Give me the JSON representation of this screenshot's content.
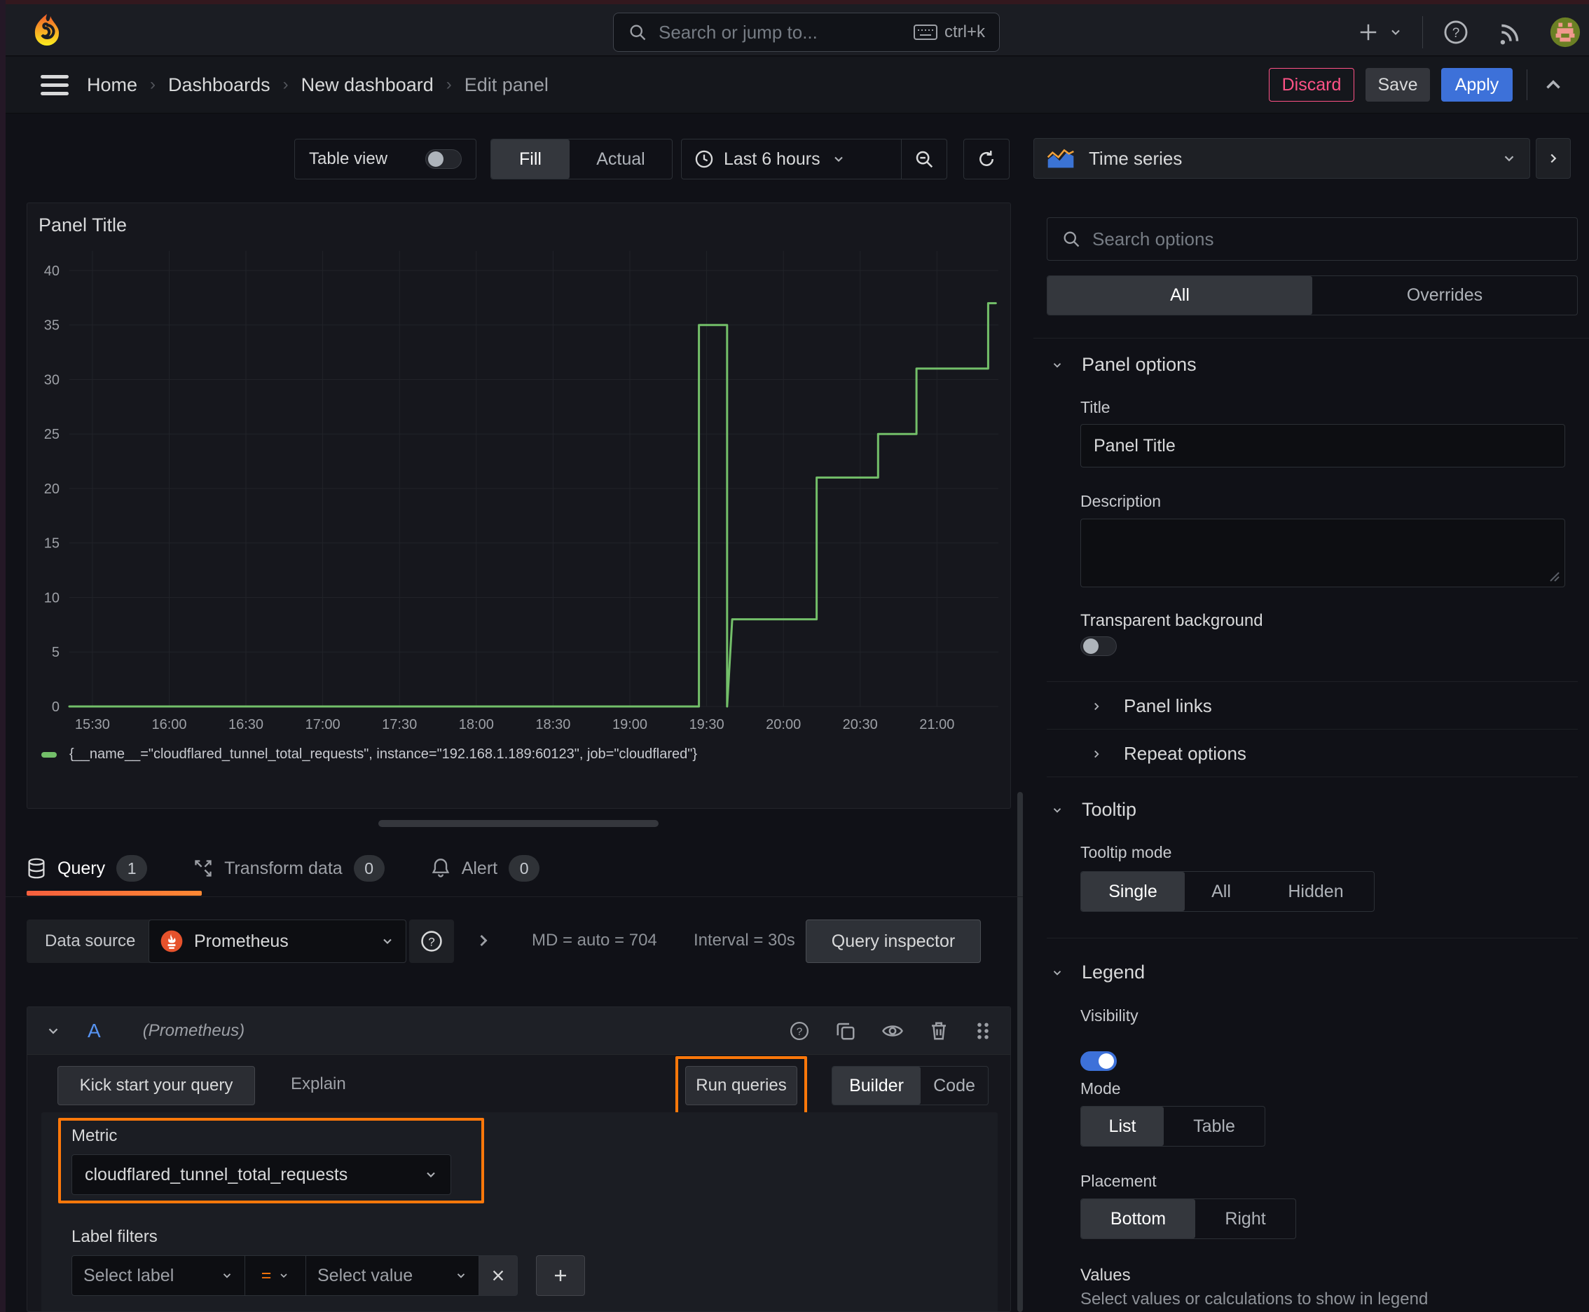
{
  "nav": {
    "search_placeholder": "Search or jump to...",
    "shortcut": "ctrl+k"
  },
  "breadcrumb": {
    "items": [
      "Home",
      "Dashboards",
      "New dashboard",
      "Edit panel"
    ]
  },
  "actions": {
    "discard": "Discard",
    "save": "Save",
    "apply": "Apply"
  },
  "toolbar": {
    "table_view": "Table view",
    "fill": "Fill",
    "actual": "Actual",
    "time_range": "Last 6 hours"
  },
  "viz": {
    "name": "Time series"
  },
  "panel": {
    "title": "Panel Title"
  },
  "chart_data": {
    "type": "line",
    "title": "Panel Title",
    "xlabel": "",
    "ylabel": "",
    "grid": true,
    "legend_position": "bottom",
    "x_tick_labels": [
      "15:30",
      "16:00",
      "16:30",
      "17:00",
      "17:30",
      "18:00",
      "18:30",
      "19:00",
      "19:30",
      "20:00",
      "20:30",
      "21:00"
    ],
    "x_ticks_minutes": [
      930,
      960,
      990,
      1020,
      1050,
      1080,
      1110,
      1140,
      1170,
      1200,
      1230,
      1260
    ],
    "y_ticks": [
      0,
      5,
      10,
      15,
      20,
      25,
      30,
      35,
      40
    ],
    "ylim": [
      0,
      41.8
    ],
    "x_domain_minutes": [
      921,
      1284
    ],
    "series": [
      {
        "name": "{__name__=\"cloudflared_tunnel_total_requests\", instance=\"192.168.1.189:60123\", job=\"cloudflared\"}",
        "color": "#73bf69",
        "points": [
          [
            921,
            0
          ],
          [
            1167,
            0
          ],
          [
            1167,
            35
          ],
          [
            1178,
            35
          ],
          [
            1178,
            0
          ],
          [
            1180,
            8
          ],
          [
            1213,
            8
          ],
          [
            1213,
            21
          ],
          [
            1237,
            21
          ],
          [
            1237,
            25
          ],
          [
            1252,
            25
          ],
          [
            1252,
            31
          ],
          [
            1280,
            31
          ],
          [
            1280,
            37
          ],
          [
            1283,
            37
          ]
        ]
      }
    ]
  },
  "tabs": {
    "query": "Query",
    "query_count": "1",
    "transform": "Transform data",
    "transform_count": "0",
    "alert": "Alert",
    "alert_count": "0"
  },
  "datasource": {
    "label": "Data source",
    "name": "Prometheus",
    "md": "MD = auto = 704",
    "interval": "Interval = 30s",
    "inspector": "Query inspector"
  },
  "editor": {
    "ref": "A",
    "hint": "(Prometheus)",
    "kickstart": "Kick start your query",
    "explain": "Explain",
    "run": "Run queries",
    "builder": "Builder",
    "code": "Code",
    "metric_label": "Metric",
    "metric": "cloudflared_tunnel_total_requests",
    "filters_label": "Label filters",
    "select_label": "Select label",
    "op": "=",
    "select_value": "Select value"
  },
  "options": {
    "search_placeholder": "Search options",
    "all_tab": "All",
    "overrides_tab": "Overrides",
    "panel": {
      "header": "Panel options",
      "title_label": "Title",
      "title_value": "Panel Title",
      "desc_label": "Description",
      "transparent": "Transparent background",
      "links": "Panel links",
      "repeat": "Repeat options"
    },
    "tooltip": {
      "header": "Tooltip",
      "mode_label": "Tooltip mode",
      "single": "Single",
      "all": "All",
      "hidden": "Hidden"
    },
    "legend": {
      "header": "Legend",
      "visibility": "Visibility",
      "mode_label": "Mode",
      "list": "List",
      "table": "Table",
      "placement": "Placement",
      "bottom": "Bottom",
      "right": "Right",
      "values": "Values",
      "hint": "Select values or calculations to show in legend"
    }
  },
  "colors": {
    "accent_orange": "#ff780a",
    "series_green": "#73bf69",
    "primary_blue": "#3d71d9",
    "discard_pink": "#ff5286"
  }
}
